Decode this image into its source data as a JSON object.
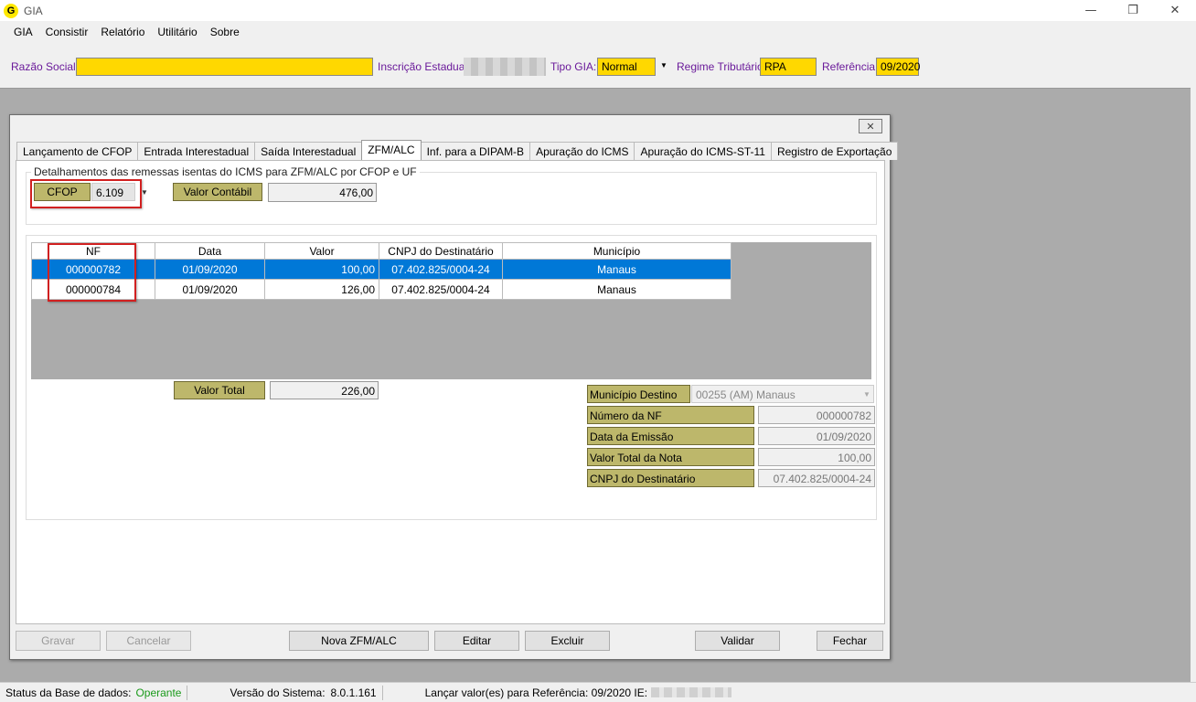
{
  "window": {
    "title": "GIA",
    "icon_letter": "G",
    "minimize": "—",
    "restore": "❐",
    "close": "✕"
  },
  "menu": [
    "GIA",
    "Consistir",
    "Relatório",
    "Utilitário",
    "Sobre"
  ],
  "header": {
    "razao_social_label": "Razão Social:",
    "razao_social_value": "",
    "inscricao_label": "Inscrição Estadual:",
    "tipo_gia_label": "Tipo GIA:",
    "tipo_gia_value": "Normal",
    "regime_label": "Regime Tributário:",
    "regime_value": "RPA",
    "referencia_label": "Referência:",
    "referencia_value": "09/2020"
  },
  "dialog": {
    "close_glyph": "✕",
    "tabs": [
      "Lançamento de CFOP",
      "Entrada Interestadual",
      "Saída Interestadual",
      "ZFM/ALC",
      "Inf. para a DIPAM-B",
      "Apuração do ICMS",
      "Apuração do ICMS-ST-11",
      "Registro de Exportação"
    ],
    "active_tab": "ZFM/ALC",
    "group_legend": "Detalhamentos das remessas isentas do ICMS para ZFM/ALC por CFOP e UF",
    "cfop_label": "CFOP",
    "cfop_value": "6.109",
    "valor_contabil_label": "Valor Contábil",
    "valor_contabil_value": "476,00",
    "grid": {
      "columns": [
        "NF",
        "Data",
        "Valor",
        "CNPJ do Destinatário",
        "Município"
      ],
      "rows": [
        {
          "nf": "000000782",
          "data": "01/09/2020",
          "valor": "100,00",
          "cnpj": "07.402.825/0004-24",
          "municipio": "Manaus",
          "selected": true
        },
        {
          "nf": "000000784",
          "data": "01/09/2020",
          "valor": "126,00",
          "cnpj": "07.402.825/0004-24",
          "municipio": "Manaus",
          "selected": false
        }
      ]
    },
    "valor_total_label": "Valor Total",
    "valor_total_value": "226,00",
    "detail": {
      "municipio_label": "Município Destino",
      "municipio_value": "00255 (AM) Manaus",
      "numero_nf_label": "Número da NF",
      "numero_nf_value": "000000782",
      "data_emissao_label": "Data da Emissão",
      "data_emissao_value": "01/09/2020",
      "valor_nota_label": "Valor Total da Nota",
      "valor_nota_value": "100,00",
      "cnpj_label": "CNPJ do Destinatário",
      "cnpj_value": "07.402.825/0004-24"
    },
    "buttons": {
      "gravar": "Gravar",
      "cancelar": "Cancelar",
      "nova": "Nova ZFM/ALC",
      "editar": "Editar",
      "excluir": "Excluir",
      "validar": "Validar",
      "fechar": "Fechar"
    }
  },
  "status": {
    "base_label": "Status da Base de dados:",
    "base_value": "Operante",
    "versao_label": "Versão do Sistema:",
    "versao_value": "8.0.1.161",
    "lancar_label": "Lançar valor(es) para Referência: 09/2020 IE:"
  },
  "colors": {
    "accent_yellow": "#ffd800",
    "olive": "#bdb76b",
    "label_purple": "#6a1a9a",
    "selection_blue": "#0078d7",
    "status_green": "#1a9a1a"
  }
}
